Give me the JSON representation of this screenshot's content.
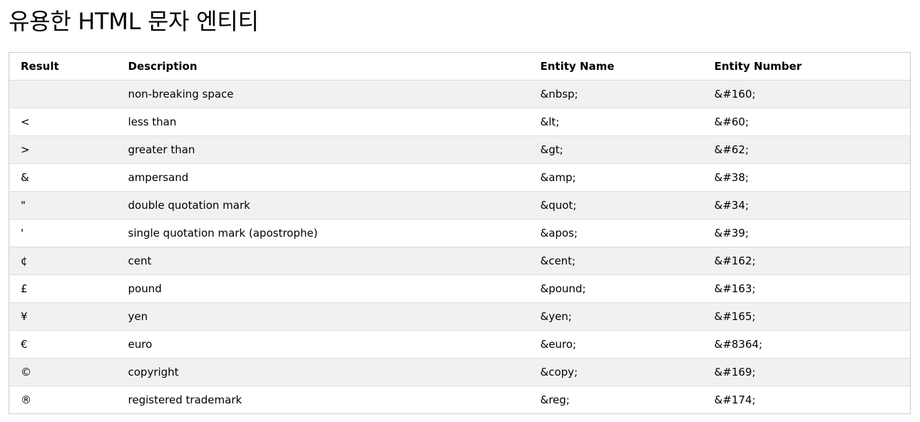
{
  "page": {
    "title": "유용한 HTML 문자 엔티티"
  },
  "table": {
    "headers": {
      "result": "Result",
      "description": "Description",
      "entity_name": "Entity Name",
      "entity_number": "Entity Number"
    },
    "rows": [
      {
        "result": " ",
        "description": "non-breaking space",
        "entity_name": "&nbsp;",
        "entity_number": "&#160;"
      },
      {
        "result": "<",
        "description": "less than",
        "entity_name": "&lt;",
        "entity_number": "&#60;"
      },
      {
        "result": ">",
        "description": "greater than",
        "entity_name": "&gt;",
        "entity_number": "&#62;"
      },
      {
        "result": "&",
        "description": "ampersand",
        "entity_name": "&amp;",
        "entity_number": "&#38;"
      },
      {
        "result": "\"",
        "description": "double quotation mark",
        "entity_name": "&quot;",
        "entity_number": "&#34;"
      },
      {
        "result": "'",
        "description": "single quotation mark (apostrophe)",
        "entity_name": "&apos;",
        "entity_number": "&#39;"
      },
      {
        "result": "¢",
        "description": "cent",
        "entity_name": "&cent;",
        "entity_number": "&#162;"
      },
      {
        "result": "£",
        "description": "pound",
        "entity_name": "&pound;",
        "entity_number": "&#163;"
      },
      {
        "result": "¥",
        "description": "yen",
        "entity_name": "&yen;",
        "entity_number": "&#165;"
      },
      {
        "result": "€",
        "description": "euro",
        "entity_name": "&euro;",
        "entity_number": "&#8364;"
      },
      {
        "result": "©",
        "description": "copyright",
        "entity_name": "&copy;",
        "entity_number": "&#169;"
      },
      {
        "result": "®",
        "description": "registered trademark",
        "entity_name": "&reg;",
        "entity_number": "&#174;"
      }
    ]
  },
  "colors": {
    "odd_row_background": "#f1f1f1",
    "even_row_background": "#ffffff",
    "table_border": "#cccccc",
    "row_divider": "#dddddd",
    "text": "#000000"
  }
}
